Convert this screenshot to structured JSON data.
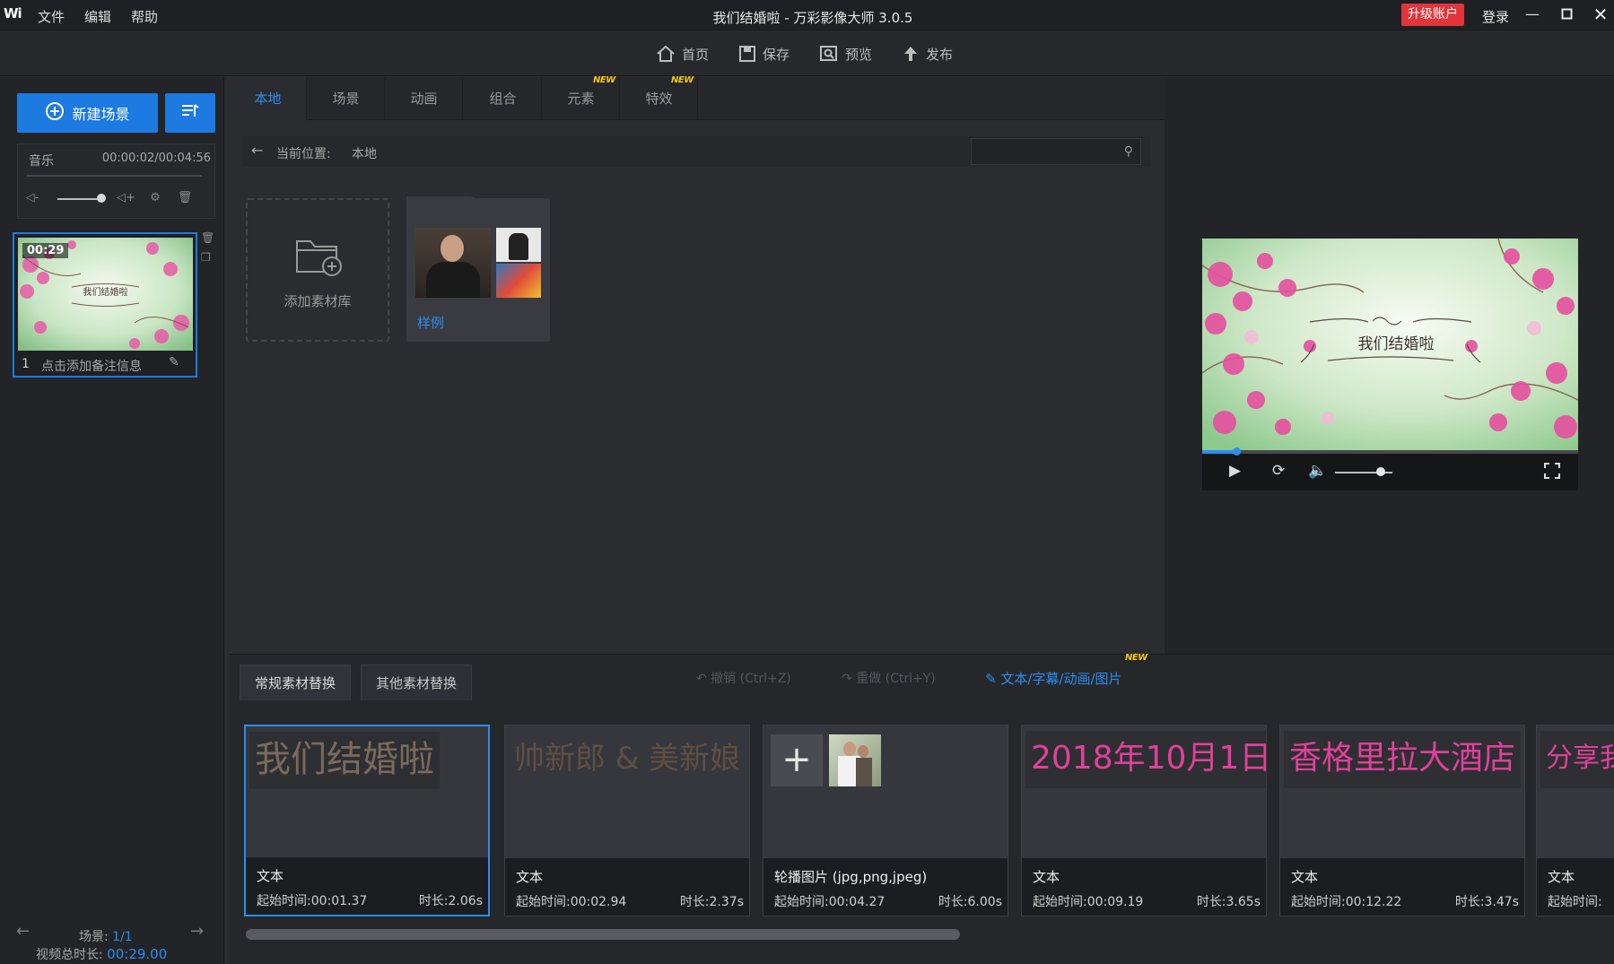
{
  "app": {
    "logo": "Wi",
    "title": "我们结婚啦 - 万彩影像大师 3.0.5",
    "menu": [
      "文件",
      "编辑",
      "帮助"
    ],
    "upgrade_label": "升级账户",
    "login_label": "登录",
    "window_controls": [
      "minimize-icon",
      "maximize-icon",
      "close-icon"
    ]
  },
  "toolbar": {
    "home_label": "首页",
    "save_label": "保存",
    "preview_label": "预览",
    "publish_label": "发布"
  },
  "left_panel": {
    "new_scene_label": "新建场景",
    "music": {
      "label": "音乐",
      "time": "00:00:02/00:04:56"
    },
    "scene": {
      "duration": "00:29",
      "index": "1",
      "note_placeholder": "点击添加备注信息",
      "thumb_title": "我们结婚啦"
    },
    "scene_counter_label": "场景:",
    "scene_counter_value": "1/1",
    "total_duration_label": "视频总时长:",
    "total_duration_value": "00:29.00"
  },
  "library": {
    "tabs": [
      {
        "label": "本地",
        "new": false
      },
      {
        "label": "场景",
        "new": false
      },
      {
        "label": "动画",
        "new": false
      },
      {
        "label": "组合",
        "new": false
      },
      {
        "label": "元素",
        "new": true
      },
      {
        "label": "特效",
        "new": true
      }
    ],
    "new_badge": "NEW",
    "breadcrumb_label": "当前位置:",
    "breadcrumb_value": "本地",
    "search_placeholder": "",
    "add_library_label": "添加素材库",
    "sample_folder_label": "样例"
  },
  "preview": {
    "title_text": "我们结婚啦",
    "progress": 0.09,
    "volume": 0.8
  },
  "timeline": {
    "tabs": [
      "常规素材替换",
      "其他素材替换"
    ],
    "undo_label": "撤销 (Ctrl+Z)",
    "redo_label": "重做 (Ctrl+Y)",
    "edit_link": "文本/字幕/动画/图片",
    "edit_new_badge": "NEW",
    "clips": [
      {
        "preview_text": "我们结婚啦",
        "type": "文本",
        "start": "起始时间:00:01.37",
        "duration": "时长:2.06s",
        "text_color": "#7a6a5c"
      },
      {
        "preview_text": "帅新郎 & 美新娘",
        "type": "文本",
        "start": "起始时间:00:02.94",
        "duration": "时长:2.37s",
        "text_color": "#5e4f44"
      },
      {
        "preview_text": "",
        "type": "轮播图片 (jpg,png,jpeg)",
        "start": "起始时间:00:04.27",
        "duration": "时长:6.00s",
        "text_color": ""
      },
      {
        "preview_text": "2018年10月1日",
        "type": "文本",
        "start": "起始时间:00:09.19",
        "duration": "时长:3.65s",
        "text_color": "#e0409a"
      },
      {
        "preview_text": "香格里拉大酒店",
        "type": "文本",
        "start": "起始时间:00:12.22",
        "duration": "时长:3.47s",
        "text_color": "#e0409a"
      },
      {
        "preview_text": "分享我",
        "type": "文本",
        "start": "起始时间:",
        "duration": "",
        "text_color": "#e0409a"
      }
    ]
  },
  "colors": {
    "accent": "#1c7ae0",
    "link": "#2a8ef0",
    "upgrade": "#e1353b",
    "new_badge": "#f5c518"
  }
}
